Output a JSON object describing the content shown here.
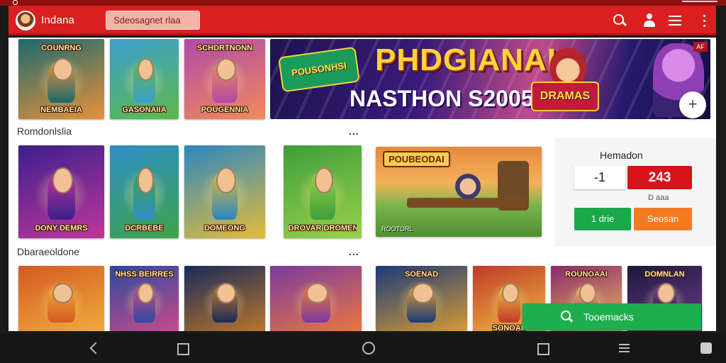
{
  "appbar": {
    "title": "Indana",
    "search_text": "Sdeosagnet rlaa",
    "icons": [
      "search-icon",
      "account-icon",
      "list-icon",
      "more-vert-icon"
    ]
  },
  "banner": {
    "logo_text": "POUSONHSI",
    "title": "PHDGIANAI",
    "subtitle": "NASTHON S2005",
    "badge_text": "DRAMAS",
    "corner_text": "AF"
  },
  "top_row": [
    {
      "caption_top": "COUNRNG",
      "caption_bottom": "NEMBAEIA",
      "colors": [
        "#1b6a6e",
        "#e8913a"
      ]
    },
    {
      "caption_top": "",
      "caption_bottom": "GASONAIIA",
      "colors": [
        "#3d9fd0",
        "#5cb84a"
      ]
    },
    {
      "caption_top": "SCHDRTNONN",
      "caption_bottom": "POUGENNIA",
      "colors": [
        "#b04aa8",
        "#f08a5a"
      ]
    }
  ],
  "sections": {
    "recommended": "Romdonlslia",
    "second": "Dbaraeoldone",
    "more": "..."
  },
  "mid_row": [
    {
      "caption_top": "",
      "caption_bottom": "DONY DEMRS",
      "colors": [
        "#3b1f8c",
        "#c0369a"
      ]
    },
    {
      "caption_top": "",
      "caption_bottom": "DCRBEBE",
      "colors": [
        "#2f8fc8",
        "#3ea34a"
      ]
    },
    {
      "caption_top": "",
      "caption_bottom": "DOMEONG",
      "colors": [
        "#2a87c0",
        "#e4bb3a"
      ]
    },
    {
      "caption_top": "",
      "caption_bottom": "DROVAR DROMENK",
      "colors": [
        "#3e9e3a",
        "#9ad14b"
      ]
    }
  ],
  "wide_tile": {
    "title": "POUBEODAI",
    "meta": "ROOTORL"
  },
  "score_panel": {
    "title": "Hemadon",
    "stepper_value": "-1",
    "score": "243",
    "note": "D aaa",
    "green_label": "1 drie",
    "orange_label": "Seosan"
  },
  "bottom_row": [
    {
      "caption_top": "",
      "caption_bottom": "",
      "colors": [
        "#d55a20",
        "#f0b040"
      ]
    },
    {
      "caption_top": "NHSS BEIRRES",
      "caption_bottom": "",
      "colors": [
        "#2a4aa0",
        "#d24a8a"
      ]
    },
    {
      "caption_top": "",
      "caption_bottom": "",
      "colors": [
        "#1a2a5a",
        "#c07a2a"
      ]
    },
    {
      "caption_top": "",
      "caption_bottom": "",
      "colors": [
        "#7a3aa0",
        "#f07a3a"
      ]
    },
    {
      "caption_top": "SOENAD",
      "caption_bottom": "",
      "colors": [
        "#1a3a7a",
        "#e0a030"
      ]
    },
    {
      "caption_top": "",
      "caption_bottom": "SONOAL",
      "colors": [
        "#c03a2a",
        "#f0c040"
      ]
    },
    {
      "caption_top": "ROUNOAAI",
      "caption_bottom": "",
      "colors": [
        "#8a2a6a",
        "#f0c060"
      ]
    },
    {
      "caption_top": "DOMNLAN",
      "caption_bottom": "",
      "colors": [
        "#1a1a3a",
        "#7a3a9a"
      ]
    }
  ],
  "fab_search": {
    "label": "Tooemacks"
  },
  "colors": {
    "appbar": "#d91f1f",
    "score_red": "#d6141a",
    "green": "#1aa84a",
    "orange": "#f47a22"
  }
}
